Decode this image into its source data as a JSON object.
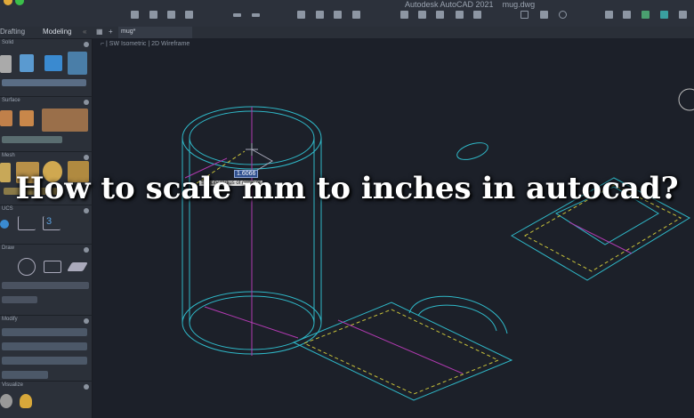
{
  "window": {
    "app_title": "Autodesk AutoCAD 2021",
    "file_name": "mug.dwg"
  },
  "workspace_tabs": [
    {
      "label": "Drafting"
    },
    {
      "label": "Modeling"
    }
  ],
  "document_tab": {
    "label": "mug*"
  },
  "viewport": {
    "view": "SW Isometric",
    "visual_style": "2D Wireframe"
  },
  "sidebar": {
    "sections": [
      {
        "label": "Solid"
      },
      {
        "label": "Surface"
      },
      {
        "label": "Mesh"
      },
      {
        "label": "UCS"
      },
      {
        "label": "Draw"
      },
      {
        "label": "Modify"
      },
      {
        "label": "Visualize"
      }
    ]
  },
  "command": {
    "dynamic_input_value": "1.6066",
    "prompt": "Specify radius of circle or"
  },
  "headline": "How to scale mm to inches in autocad?",
  "colors": {
    "cyan": "#2fb8c8",
    "magenta": "#b03ab0",
    "yellow": "#c8c23a",
    "background": "#1c2029"
  }
}
